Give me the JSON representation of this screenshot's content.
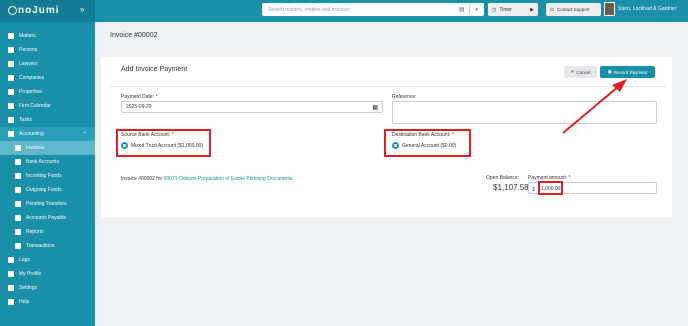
{
  "sidebar": {
    "logo": "noJumi",
    "collapse_icon": "double-chevron-right",
    "items": [
      {
        "label": "Matters"
      },
      {
        "label": "Persons"
      },
      {
        "label": "Lawyers"
      },
      {
        "label": "Companies"
      },
      {
        "label": "Properties"
      },
      {
        "label": "Firm Calendar"
      },
      {
        "label": "Tasks"
      },
      {
        "label": "Accounting"
      },
      {
        "label": "Invoices"
      },
      {
        "label": "Bank Accounts"
      },
      {
        "label": "Incoming Funds"
      },
      {
        "label": "Outgoing Funds"
      },
      {
        "label": "Pending Transfers"
      },
      {
        "label": "Accounts Payable"
      },
      {
        "label": "Reports"
      },
      {
        "label": "Transactions"
      },
      {
        "label": "Logs"
      },
      {
        "label": "My Profile"
      },
      {
        "label": "Settings"
      },
      {
        "label": "Help"
      }
    ]
  },
  "topbar": {
    "search_placeholder": "Search matters, entities and invoices",
    "timer_label": "Timer",
    "contact_label": "Contact Support",
    "user_name": "Stern, Lockhart & Gardner"
  },
  "page": {
    "title": "Invoice #00002"
  },
  "form": {
    "title": "Add Invoice Payment",
    "cancel_label": "Cancel",
    "record_label": "Record Payment",
    "payment_date_label": "Payment Date:",
    "payment_date_value": "2025-09-29",
    "reference_label": "Reference:",
    "source_label": "Source Bank Account:",
    "source_option": "Mixed Trust Account ($1,000.00)",
    "dest_label": "Destination Bank Account:",
    "dest_option": "General Account ($0.00)",
    "invoice_prefix": "Invoice #00002 for",
    "invoice_link": "00071-Dobson-Preparation of Estate Planning Documents",
    "balance_label": "Open Balance:",
    "balance_value": "$1,107.58",
    "amount_label": "Payment amount:",
    "currency": "$",
    "amount_value": "1,000.00",
    "required_mark": "*"
  },
  "colors": {
    "brand": "#1a8fa8",
    "highlight": "#e02020"
  }
}
